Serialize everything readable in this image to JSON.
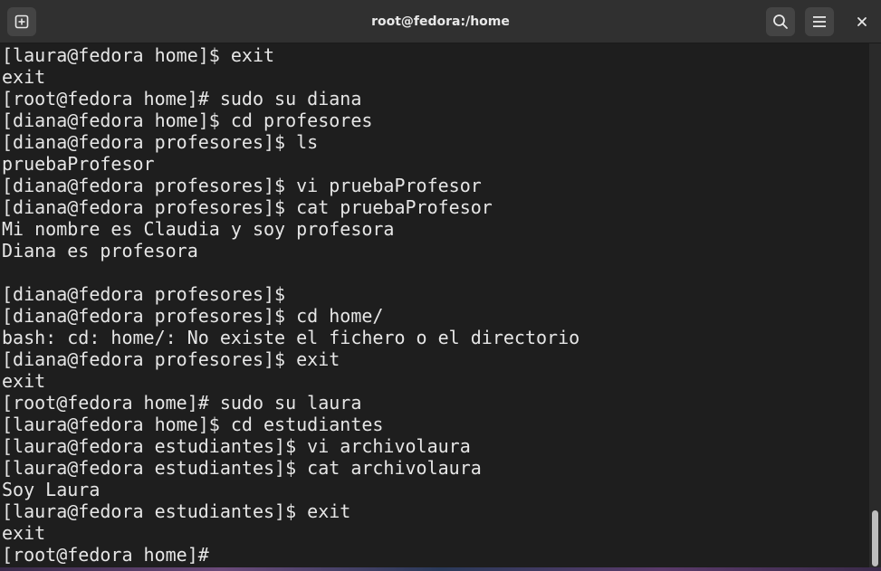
{
  "window": {
    "title": "root@fedora:/home"
  },
  "titlebar": {
    "icons": [
      "new-tab-icon",
      "search-icon",
      "menu-icon",
      "close-icon"
    ],
    "close_glyph": "×"
  },
  "terminal": {
    "lines": [
      "[laura@fedora home]$ exit",
      "exit",
      "[root@fedora home]# sudo su diana",
      "[diana@fedora home]$ cd profesores",
      "[diana@fedora profesores]$ ls",
      "pruebaProfesor",
      "[diana@fedora profesores]$ vi pruebaProfesor",
      "[diana@fedora profesores]$ cat pruebaProfesor",
      "Mi nombre es Claudia y soy profesora",
      "Diana es profesora",
      "",
      "[diana@fedora profesores]$",
      "[diana@fedora profesores]$ cd home/",
      "bash: cd: home/: No existe el fichero o el directorio",
      "[diana@fedora profesores]$ exit",
      "exit",
      "[root@fedora home]# sudo su laura",
      "[laura@fedora home]$ cd estudiantes",
      "[laura@fedora estudiantes]$ vi archivolaura",
      "[laura@fedora estudiantes]$ cat archivolaura",
      "Soy Laura",
      "[laura@fedora estudiantes]$ exit",
      "exit",
      "[root@fedora home]#"
    ]
  },
  "colors": {
    "background": "#1e1e1e",
    "foreground": "#e6e6e6",
    "titlebar": "#303030"
  }
}
